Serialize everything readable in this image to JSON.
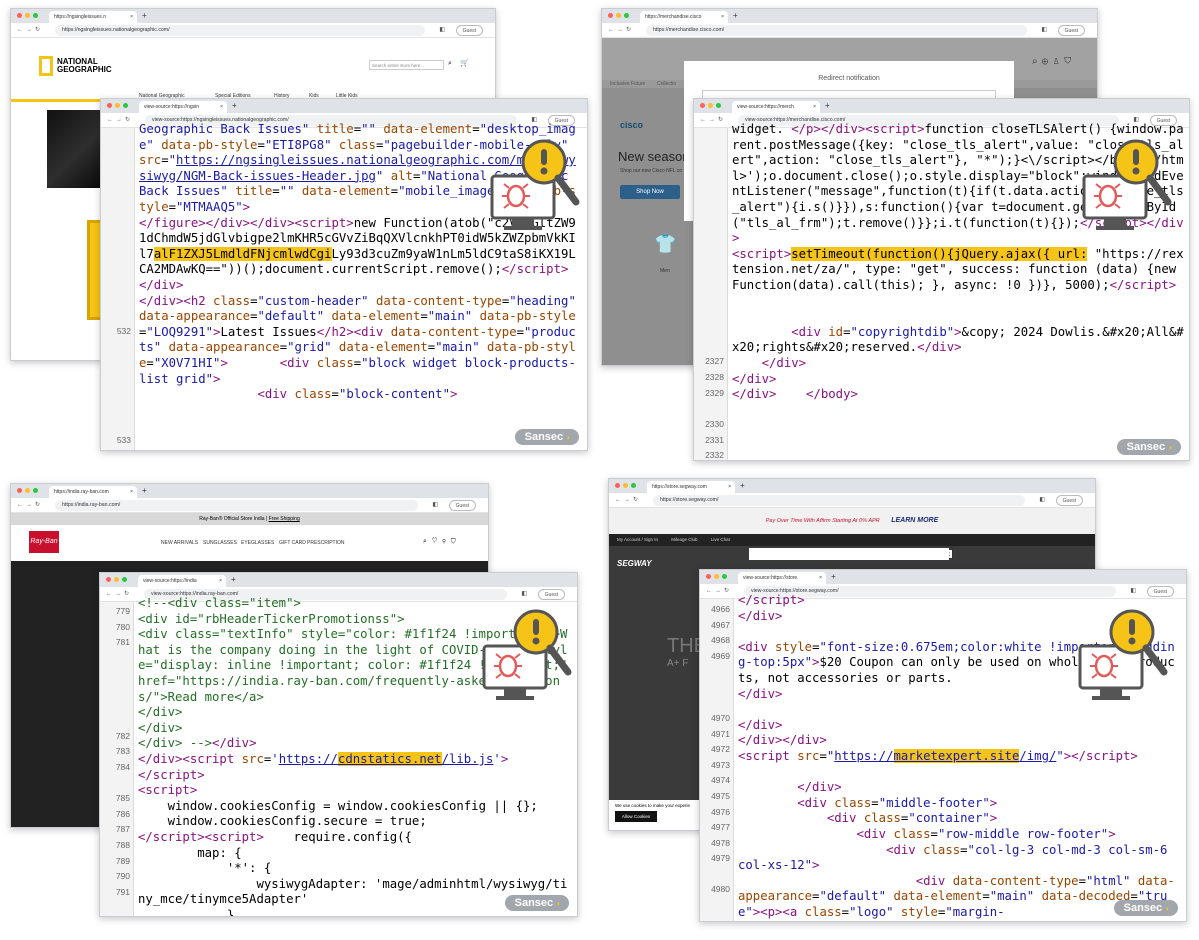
{
  "q1": {
    "bg": {
      "tab": "https://ngsingleissues.n",
      "url": "https://ngsingleissues.nationalgeographic.com/",
      "logo_line1": "NATIONAL",
      "logo_line2": "GEOGRAPHIC",
      "search": "Search entire store here...",
      "nav": [
        "National Geographic",
        "Special Editions",
        "History",
        "Kids",
        "Little Kids"
      ]
    },
    "fg": {
      "tab": "view-source:https://ngsin",
      "url": "view-source:https://ngsingleissues.nationalgeographic.com/",
      "guest": "Guest",
      "ln532": "532",
      "ln533": "533"
    }
  },
  "q2": {
    "bg": {
      "tab": "https://merchandise.cisco",
      "url": "https://merchandise.cisco.com/",
      "modal": "Redirect notification",
      "hero": "New season",
      "hero_sub": "Shop our new Cisco NFL co",
      "btn": "Shop Now",
      "strip": "Inclusive Future",
      "strip2": "Collectio",
      "product": "Men"
    },
    "fg": {
      "tab": "view-source:https://merch",
      "url": "view-source:https://merchandise.cisco.com/",
      "guest": "Guest",
      "ln": [
        "2327",
        "2328",
        "2329",
        "2330",
        "2331",
        "2332"
      ]
    }
  },
  "q3": {
    "bg": {
      "tab": "https://india.ray-ban.com",
      "url": "https://india.ray-ban.com/",
      "promo": "Ray-Ban® Official Store India",
      "promo_link": "Free Shipping",
      "logo": "Ray-Ban",
      "nav": [
        "NEW ARRIVALS",
        "SUNGLASSES",
        "EYEGLASSES",
        "GIFT CARD",
        "PRESCRIPTION"
      ]
    },
    "fg": {
      "tab": "view-source:https://india",
      "url": "view-source:https://india.ray-ban.com/",
      "guest": "Guest",
      "ln": [
        "779",
        "780",
        "781",
        "782",
        "783",
        "784",
        "785",
        "786",
        "787",
        "788",
        "789",
        "790",
        "791",
        "792"
      ]
    }
  },
  "q4": {
    "bg": {
      "tab": "https://store.segway.com",
      "url": "https://store.segway.com/",
      "banner": "Pay Over Time With Affirm Starting At 0% APR",
      "banner_link": "LEARN MORE",
      "topbar": [
        "My Account / Sign In",
        "Mileage Club",
        "Live Chat"
      ],
      "logo": "SEGWAY",
      "hero": "THE",
      "hero_sub": "A+ F",
      "cookie": "We use cookies to make your experie",
      "cookie_btn": "Allow Cookies"
    },
    "fg": {
      "tab": "view-source:https://store.",
      "url": "view-source:https://store.segway.com/",
      "guest": "Guest",
      "ln": [
        "4966",
        "4967",
        "4968",
        "4969",
        "4970",
        "4971",
        "4972",
        "4973",
        "4974",
        "4975",
        "4976",
        "4977",
        "4978",
        "4979",
        "4980"
      ]
    }
  },
  "brand": {
    "sansec": "Sansec"
  },
  "colors": {
    "highlight": "#f6c416",
    "tag": "#881280",
    "attr": "#994500",
    "value": "#1a1aa6",
    "comment": "#236e25",
    "ng_yellow": "#f6c416"
  }
}
